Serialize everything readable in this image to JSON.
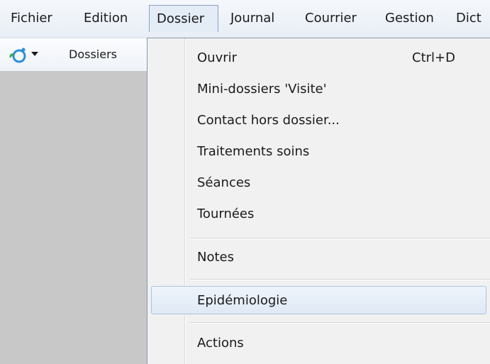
{
  "menubar": {
    "items": [
      {
        "label": "Fichier"
      },
      {
        "label": "Edition"
      },
      {
        "label": "Dossier"
      },
      {
        "label": "Journal"
      },
      {
        "label": "Courrier"
      },
      {
        "label": "Gestion"
      },
      {
        "label": "Dict"
      }
    ]
  },
  "toolbar": {
    "label": "Dossiers",
    "icon": "app-logo-icon",
    "accent": "#2a8fd8"
  },
  "dropdown": {
    "items": [
      {
        "label": "Ouvrir",
        "shortcut": "Ctrl+D"
      },
      {
        "label": "Mini-dossiers 'Visite'"
      },
      {
        "label": "Contact hors dossier..."
      },
      {
        "label": "Traitements soins"
      },
      {
        "label": "Séances"
      },
      {
        "label": "Tournées"
      },
      {
        "label": "Notes"
      },
      {
        "label": "Epidémiologie"
      },
      {
        "label": "Actions"
      }
    ]
  }
}
